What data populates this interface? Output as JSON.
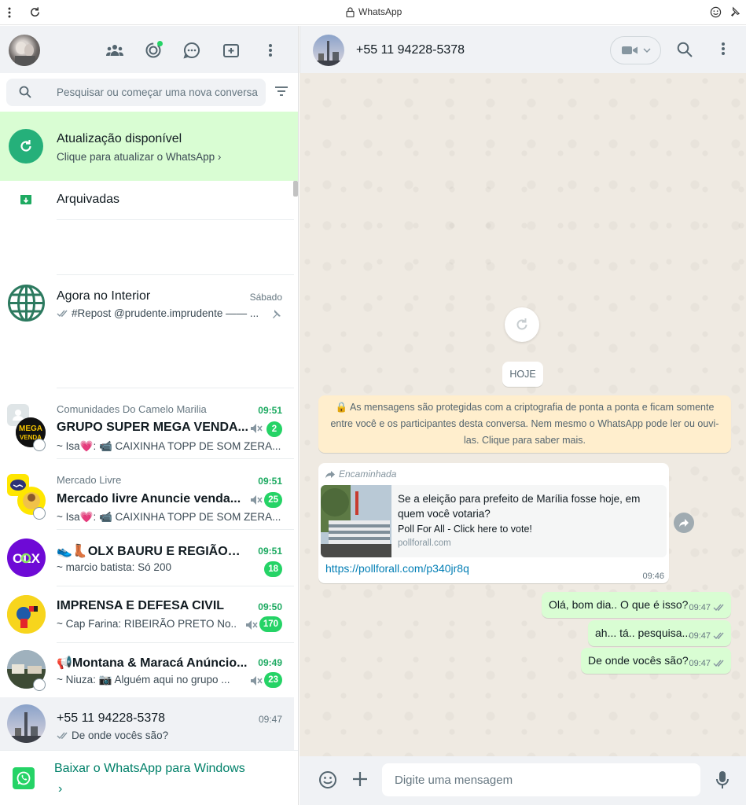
{
  "browser": {
    "title": "WhatsApp",
    "icons": [
      "menu-dots-icon",
      "reload-icon",
      "lock-icon",
      "emoji-icon",
      "pin-icon"
    ]
  },
  "left_header": {
    "icons": [
      "communities-icon",
      "status-icon",
      "channels-icon",
      "new-chat-icon",
      "menu-icon"
    ]
  },
  "search": {
    "placeholder": "Pesquisar ou começar uma nova conversa"
  },
  "update_banner": {
    "title": "Atualização disponível",
    "subtitle": "Clique para atualizar o WhatsApp ›"
  },
  "archived": {
    "label": "Arquivadas"
  },
  "chats": [
    {
      "name": "Agora no Interior",
      "time": "Sábado",
      "preview": "#Repost @prudente.imprudente —— ...",
      "pinned": true
    },
    {
      "community": "Comunidades Do Camelo Marilia",
      "name": "GRUPO SUPER MEGA VENDA...",
      "time": "09:51",
      "preview": "~ Isa💗: 📹 CAIXINHA TOPP DE SOM ZERA...",
      "badge": "2",
      "muted": true
    },
    {
      "community": "Mercado Livre",
      "name": "Mercado livre Anuncie venda...",
      "time": "09:51",
      "preview": "~ Isa💗: 📹 CAIXINHA TOPP DE SOM ZERA...",
      "badge": "25",
      "muted": true
    },
    {
      "name": "👟👢OLX BAURU E REGIÃO👠👚",
      "time": "09:51",
      "preview": "~ marcio batista: Só 200",
      "badge": "18"
    },
    {
      "name": "IMPRENSA E DEFESA CIVIL",
      "time": "09:50",
      "preview": "~ Cap Farina: RIBEIRÃO PRETO  No...",
      "badge": "170",
      "muted": true
    },
    {
      "name": "📢Montana & Maracá Anúncio...",
      "time": "09:49",
      "preview": "~ Niuza: 📷 Alguém aqui no grupo ...",
      "badge": "23",
      "muted": true
    },
    {
      "name": "+55 11 94228-5378",
      "time": "09:47",
      "preview": "De onde vocês são?"
    }
  ],
  "windows_cta": {
    "label": "Baixar o WhatsApp para Windows",
    "chevron": "›"
  },
  "conversation": {
    "contact": "+55 11 94228-5378",
    "date_pill": "HOJE",
    "e2e_notice": "🔒 As mensagens são protegidas com a criptografia de ponta a ponta e ficam somente entre você e os participantes desta conversa. Nem mesmo o WhatsApp pode ler ou ouvi-las. Clique para saber mais.",
    "incoming": {
      "forwarded_label": "Encaminhada",
      "preview_title": "Se a eleição para prefeito de Marília fosse hoje, em quem você votaria?",
      "preview_subtitle": "Poll For All - Click here to vote!",
      "preview_domain": "pollforall.com",
      "link": "https://pollforall.com/p340jr8q",
      "time": "09:46"
    },
    "outgoing": [
      {
        "text": "Olá, bom dia.. O que é isso?",
        "time": "09:47"
      },
      {
        "text": "ah... tá.. pesquisa...",
        "time": "09:47"
      },
      {
        "text": "De onde vocês são?",
        "time": "09:47"
      }
    ]
  },
  "composer": {
    "placeholder": "Digite uma mensagem"
  },
  "colors": {
    "accent_green": "#25d366",
    "banner_green": "#d9fdd3",
    "link_blue": "#027eb5",
    "wallpaper": "#efeae2",
    "notice_yellow": "#ffeecd"
  }
}
